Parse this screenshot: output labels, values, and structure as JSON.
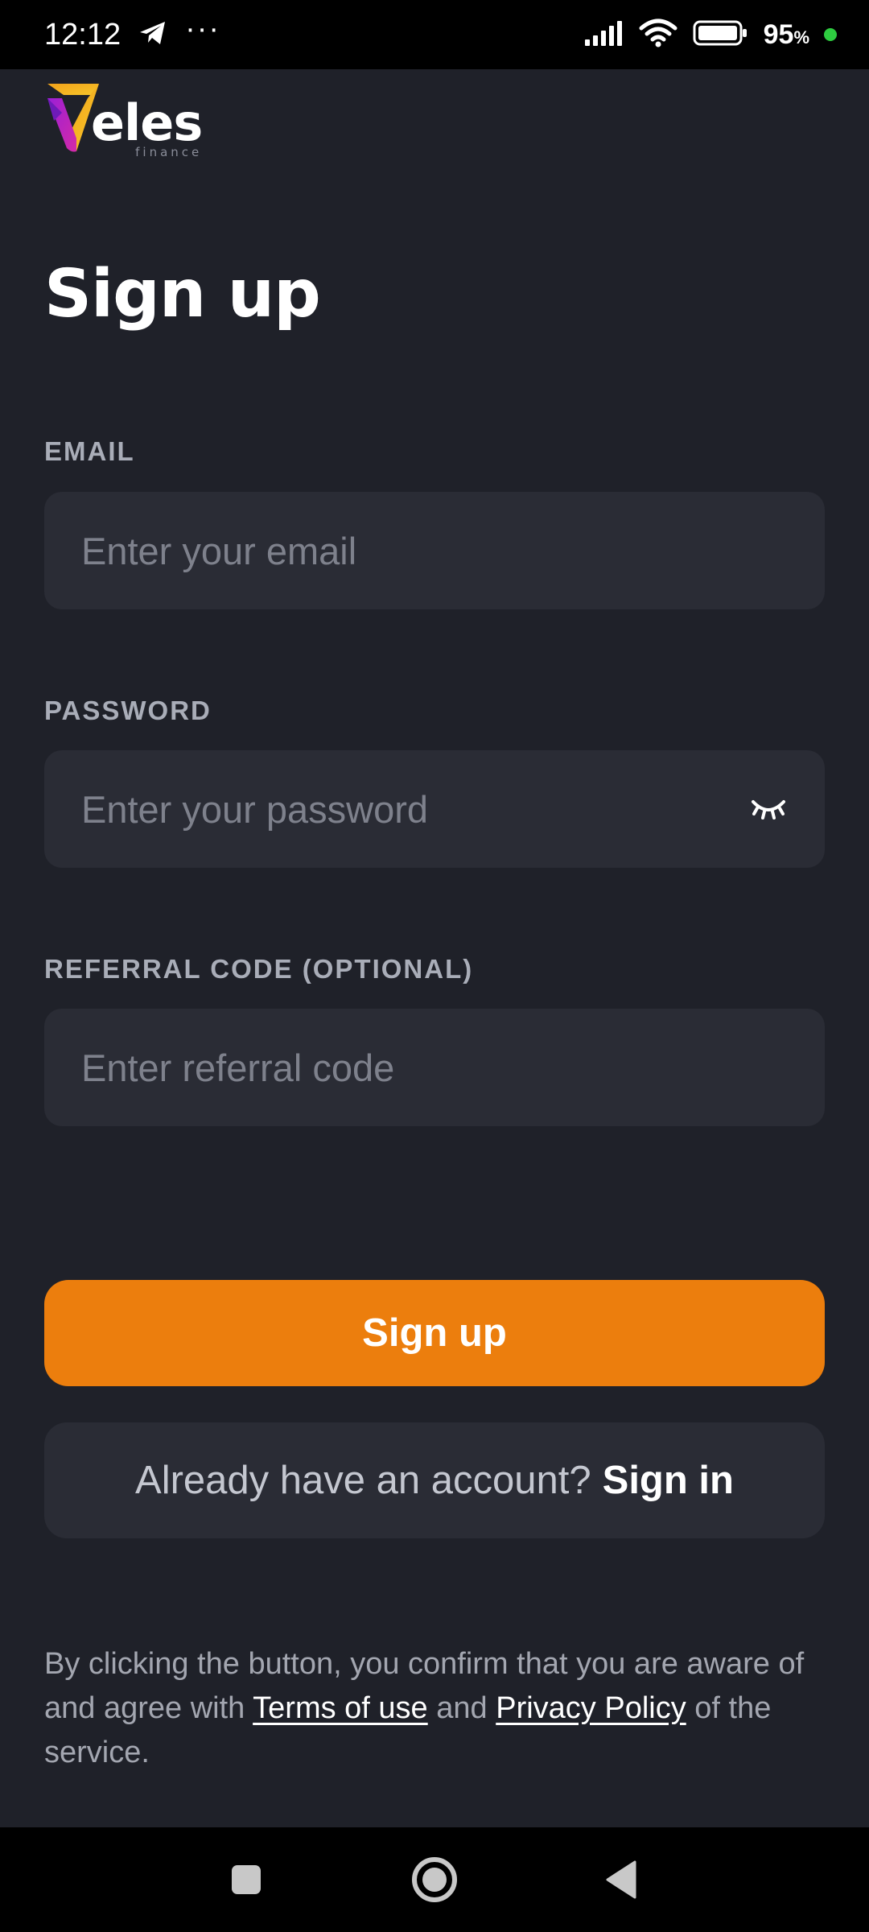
{
  "status_bar": {
    "time": "12:12",
    "more": "···",
    "battery_percent": "95",
    "battery_unit": "%",
    "colors": {
      "charging_dot": "#2ecc40"
    }
  },
  "logo": {
    "name": "eles",
    "subtitle": "finance"
  },
  "page": {
    "title": "Sign up"
  },
  "form": {
    "email": {
      "label": "EMAIL",
      "placeholder": "Enter your email"
    },
    "password": {
      "label": "PASSWORD",
      "placeholder": "Enter your password",
      "toggle_icon": "eye-closed-icon"
    },
    "referral": {
      "label": "REFERRAL CODE (OPTIONAL)",
      "placeholder": "Enter referral code"
    }
  },
  "actions": {
    "signup_label": "Sign up",
    "already_text": "Already have an account?",
    "signin_label": "Sign in"
  },
  "legal": {
    "part1": "By clicking the button, you confirm that you are aware of and agree with ",
    "terms": "Terms of use",
    "and": " and ",
    "privacy": "Privacy Policy",
    "part2": " of the service."
  },
  "colors": {
    "background": "#1f2129",
    "field": "#2a2c35",
    "accent": "#ec7e0d"
  }
}
